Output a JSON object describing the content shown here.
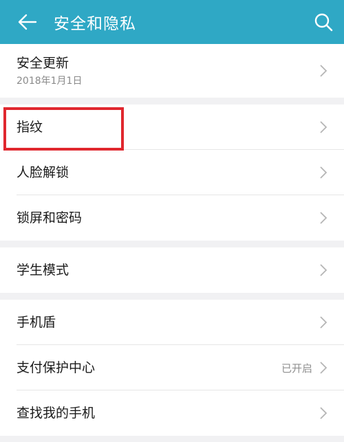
{
  "header": {
    "title": "安全和隐私",
    "back_icon": "arrow-left-icon",
    "search_icon": "search-icon",
    "color": "#2fa8c5"
  },
  "groups": [
    {
      "items": [
        {
          "label": "安全更新",
          "sub": "2018年1月1日",
          "status": ""
        }
      ]
    },
    {
      "items": [
        {
          "label": "指纹",
          "sub": "",
          "status": ""
        },
        {
          "label": "人脸解锁",
          "sub": "",
          "status": ""
        },
        {
          "label": "锁屏和密码",
          "sub": "",
          "status": ""
        }
      ]
    },
    {
      "items": [
        {
          "label": "学生模式",
          "sub": "",
          "status": ""
        }
      ]
    },
    {
      "items": [
        {
          "label": "手机盾",
          "sub": "",
          "status": ""
        },
        {
          "label": "支付保护中心",
          "sub": "",
          "status": "已开启"
        },
        {
          "label": "查找我的手机",
          "sub": "",
          "status": ""
        }
      ]
    }
  ],
  "highlight": {
    "target": "指纹",
    "color": "#e0272e"
  }
}
